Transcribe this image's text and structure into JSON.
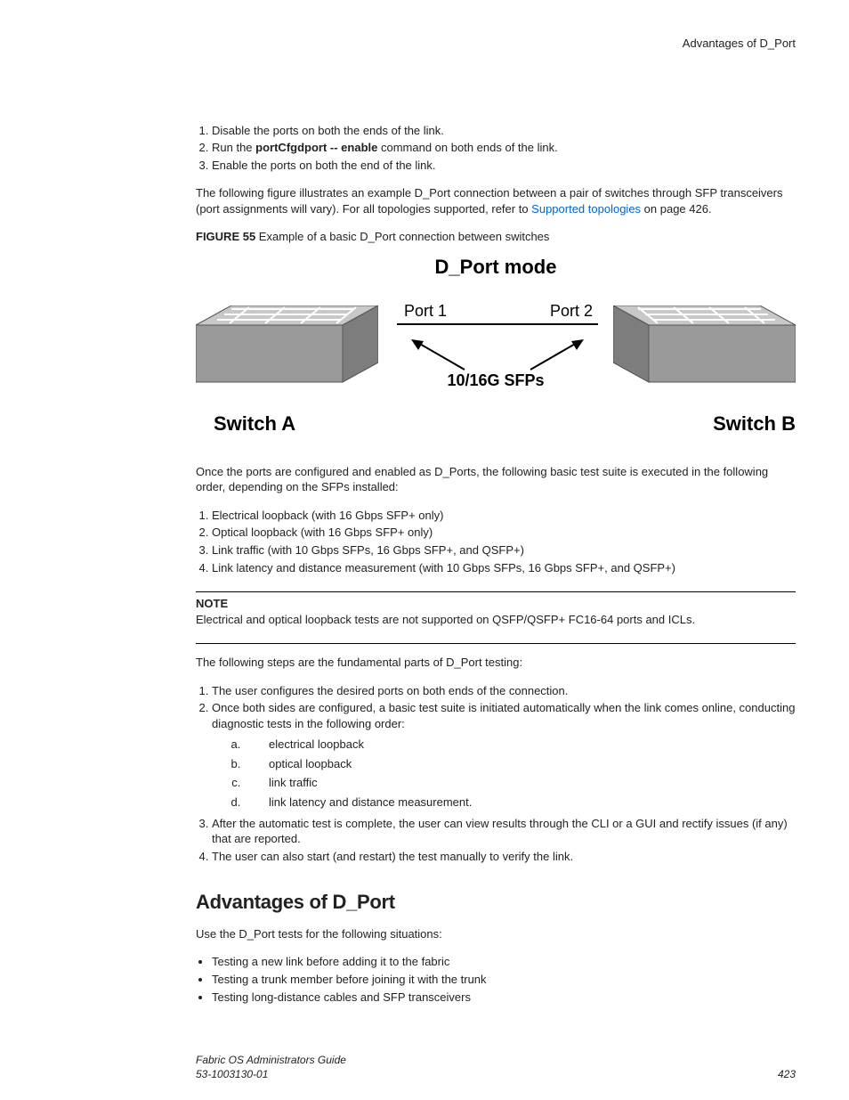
{
  "header": {
    "breadcrumb": "Advantages of D_Port"
  },
  "steps1": {
    "i1": "Disable the ports on both the ends of the link.",
    "i2_pre": "Run the ",
    "i2_bold": "portCfgdport -- enable",
    "i2_post": " command on both ends of the link.",
    "i3": "Enable the ports on both the end of the link."
  },
  "para1": {
    "pre": "The following figure illustrates an example D_Port connection between a pair of switches through SFP transceivers (port assignments will vary). For all topologies supported, refer to ",
    "link": "Supported topologies",
    "post": " on page 426."
  },
  "figcap": {
    "label": "FIGURE 55 ",
    "text": "Example of a basic D_Port connection between switches"
  },
  "figure": {
    "title": "D_Port mode",
    "port1": "Port 1",
    "port2": "Port 2",
    "sfps": "10/16G SFPs",
    "switchA": "Switch A",
    "switchB": "Switch B"
  },
  "para2": "Once the ports are configured and enabled as D_Ports, the following basic test suite is executed in the following order, depending on the SFPs installed:",
  "tests": {
    "t1": "Electrical loopback (with 16 Gbps SFP+ only)",
    "t2": "Optical loopback (with 16 Gbps SFP+ only)",
    "t3": "Link traffic (with 10 Gbps SFPs, 16 Gbps SFP+, and QSFP+)",
    "t4": "Link latency and distance measurement (with 10 Gbps SFPs, 16 Gbps SFP+, and QSFP+)"
  },
  "note": {
    "title": "NOTE",
    "body": "Electrical and optical loopback tests are not supported on QSFP/QSFP+ FC16-64 ports and ICLs."
  },
  "para3": "The following steps are the fundamental parts of D_Port testing:",
  "steps2": {
    "s1": "The user configures the desired ports on both ends of the connection.",
    "s2": "Once both sides are configured, a basic test suite is initiated automatically when the link comes online, conducting diagnostic tests in the following order:",
    "a": "electrical loopback",
    "b": "optical loopback",
    "c": "link traffic",
    "d": "link latency and distance measurement.",
    "s3": "After the automatic test is complete, the user can view results through the CLI or a GUI and rectify issues (if any) that are reported.",
    "s4": "The user can also start (and restart) the test manually to verify the link."
  },
  "section": {
    "heading": "Advantages of D_Port"
  },
  "para4": "Use the D_Port tests for the following situations:",
  "bullets": {
    "b1": "Testing a new link before adding it to the fabric",
    "b2": "Testing a trunk member before joining it with the trunk",
    "b3": "Testing long-distance cables and SFP transceivers"
  },
  "footer": {
    "line1": "Fabric OS Administrators Guide",
    "line2": "53-1003130-01",
    "page": "423"
  }
}
